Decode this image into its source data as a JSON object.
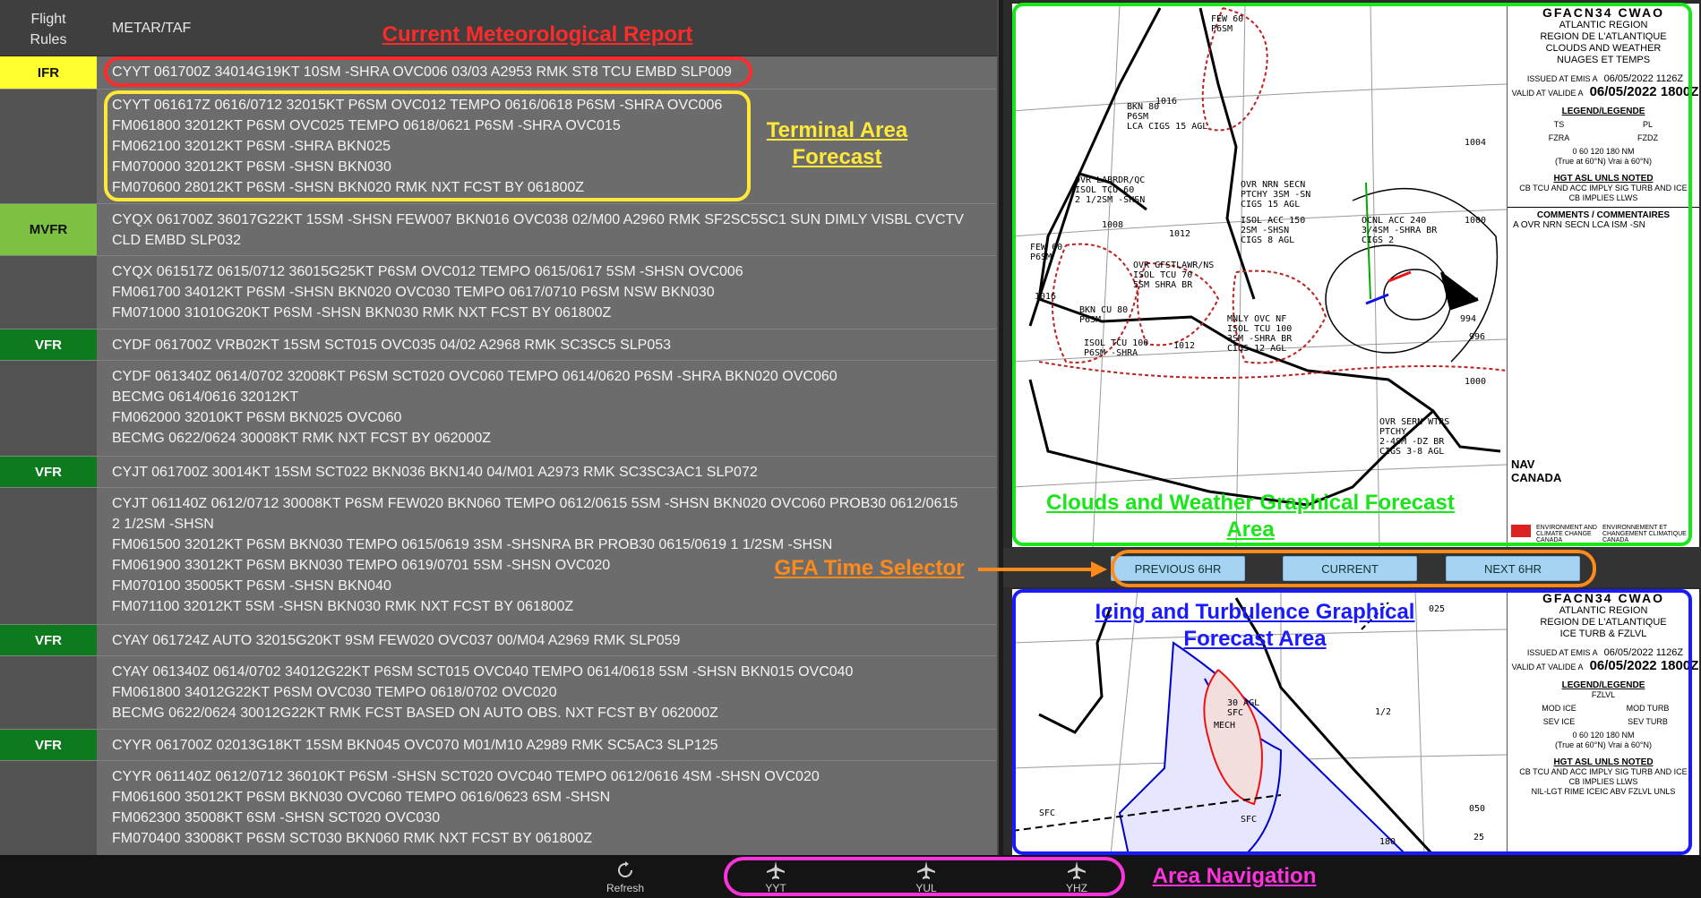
{
  "header": {
    "flight_rules": "Flight\nRules",
    "metar_taf": "METAR/TAF"
  },
  "rows": [
    {
      "rules": "IFR",
      "text": "CYYT 061700Z 34014G19KT 10SM -SHRA OVC006 03/03 A2953 RMK ST8 TCU EMBD SLP009"
    },
    {
      "rules": "",
      "text": "CYYT 061617Z 0616/0712 32015KT P6SM OVC012 TEMPO 0616/0618 P6SM -SHRA OVC006\nFM061800 32012KT P6SM OVC025 TEMPO 0618/0621 P6SM -SHRA OVC015\nFM062100 32012KT P6SM -SHRA BKN025\nFM070000 32012KT P6SM -SHSN BKN030\nFM070600 28012KT P6SM -SHSN BKN020 RMK NXT FCST BY 061800Z"
    },
    {
      "rules": "MVFR",
      "text": "CYQX 061700Z 36017G22KT 15SM -SHSN FEW007 BKN016 OVC038 02/M00 A2960 RMK SF2SC5SC1 SUN DIMLY VISBL CVCTV\nCLD EMBD SLP032"
    },
    {
      "rules": "",
      "text": "CYQX 061517Z 0615/0712 36015G25KT P6SM OVC012 TEMPO 0615/0617 5SM -SHSN OVC006\nFM061700 34012KT P6SM -SHSN BKN020 OVC030 TEMPO 0617/0710 P6SM NSW BKN030\nFM071000 31010G20KT P6SM -SHSN BKN030 RMK NXT FCST BY 061800Z"
    },
    {
      "rules": "VFR",
      "text": "CYDF 061700Z VRB02KT 15SM SCT015 OVC035 04/02 A2968 RMK SC3SC5 SLP053"
    },
    {
      "rules": "",
      "text": "CYDF 061340Z 0614/0702 32008KT P6SM SCT020 OVC060 TEMPO 0614/0620 P6SM -SHRA BKN020 OVC060\nBECMG 0614/0616 32012KT\nFM062000 32010KT P6SM BKN025 OVC060\nBECMG 0622/0624 30008KT RMK NXT FCST BY 062000Z"
    },
    {
      "rules": "VFR",
      "text": "CYJT 061700Z 30014KT 15SM SCT022 BKN036 BKN140 04/M01 A2973 RMK SC3SC3AC1 SLP072"
    },
    {
      "rules": "",
      "text": "CYJT 061140Z 0612/0712 30008KT P6SM FEW020 BKN060 TEMPO 0612/0615 5SM -SHSN BKN020 OVC060 PROB30 0612/0615\n2 1/2SM -SHSN\nFM061500 32012KT P6SM BKN030 TEMPO 0615/0619 3SM -SHSNRA BR PROB30 0615/0619 1 1/2SM -SHSN\nFM061900 33012KT P6SM BKN030 TEMPO 0619/0701 5SM -SHSN OVC020\nFM070100 35005KT P6SM -SHSN BKN040\nFM071100 32012KT 5SM -SHSN BKN030 RMK NXT FCST BY 061800Z"
    },
    {
      "rules": "VFR",
      "text": "CYAY 061724Z AUTO 32015G20KT 9SM FEW020 OVC037 00/M04 A2969 RMK SLP059"
    },
    {
      "rules": "",
      "text": "CYAY 061340Z 0614/0702 34012G22KT P6SM SCT015 OVC040 TEMPO 0614/0618 5SM -SHSN BKN015 OVC040\nFM061800 34012G22KT P6SM OVC030 TEMPO 0618/0702 OVC020\nBECMG 0622/0624 30012G22KT RMK FCST BASED ON AUTO OBS. NXT FCST BY 062000Z"
    },
    {
      "rules": "VFR",
      "text": "CYYR 061700Z 02013G18KT 15SM BKN045 OVC070 M01/M10 A2989 RMK SC5AC3 SLP125"
    },
    {
      "rules": "",
      "text": "CYYR 061140Z 0612/0712 36010KT P6SM -SHSN SCT020 OVC040 TEMPO 0612/0616 4SM -SHSN OVC020\nFM061600 35012KT P6SM BKN030 OVC060 TEMPO 0616/0623 6SM -SHSN\nFM062300 35008KT 6SM -SHSN SCT020 OVC030\nFM070400 33008KT P6SM SCT030 BKN060 RMK NXT FCST BY 061800Z"
    }
  ],
  "colors": {
    "ifr": "#ffff2e",
    "mvfr": "#7dc143",
    "vfr": "#0d7a1d",
    "annotation_red": "#ff2a2a",
    "annotation_yellow": "#ffe838",
    "annotation_green": "#19e619",
    "annotation_orange": "#ff8a1c",
    "annotation_blue": "#1a1aff",
    "annotation_magenta": "#ff33dd",
    "button_blue": "#a7d3f3"
  },
  "gfa_cw": {
    "code": "GFACN34  CWAO",
    "region_en": "ATLANTIC REGION",
    "region_fr": "REGION DE L'ATLANTIQUE",
    "product_en": "CLOUDS AND WEATHER",
    "product_fr": "NUAGES ET TEMPS",
    "issued_label": "ISSUED AT\nEMIS A",
    "issued": "06/05/2022 1126Z",
    "valid_label": "VALID AT\nVALIDE A",
    "valid": "06/05/2022 1800Z",
    "legend_title": "LEGEND/LEGENDE",
    "legend_items": [
      "TS",
      "PL",
      "FZRA",
      "FZDZ"
    ],
    "scale": "0   60  120   180 NM",
    "scale_note": "(True at 60°N)   Vrai à 60°N)",
    "hgt_note": "HGT ASL UNLS NOTED",
    "cb_note": "CB TCU AND ACC IMPLY SIG TURB AND ICE",
    "cb_note2": "CB IMPLIES LLWS",
    "comments_title": "COMMENTS / COMMENTAIRES",
    "comment": "A  OVR NRN SECN LCA ISM -SN",
    "nav_logo": "NAV\nCANADA",
    "env_text": "ENVIRONMENT AND\nCLIMATE CHANGE\nCANADA",
    "env_text_fr": "ENVIRONNEMENT ET\nCHANGEMENT CLIMATIQUE\nCANADA",
    "map_labels": [
      "BKN 80\nP6SM\nLCA CIGS 15 AGL",
      "OVR LABRDR/QC\nISOL TCU 60\n2 1/2SM -SHSN",
      "OVR NRN SECN\nPTCHY 3SM -SN\nCIGS 15 AGL",
      "ISOL ACC 150\n2SM -SHSN\nCIGS 8 AGL",
      "OVR GFSTLAWR/NS\nISOL TCU 70\n5SM SHRA BR",
      "BKN CU 80\nP6SM",
      "ISOL TCU 100\nP6SM -SHRA",
      "MNLY OVC NF\nISOL TCU 100\n3SM -SHRA BR\nCIGS 12 AGL",
      "OVR SERN WTRS\nPTCHY\n2-4SM -DZ BR\nCIGS 3-8 AGL",
      "FEW 60\nP6SM",
      "FEW 60\nP6SM",
      "OCNL ACC 240\n3/4SM -SHRA BR\nCIGS 2",
      "1004",
      "1000",
      "996",
      "994",
      "1000",
      "1012",
      "1012",
      "1016",
      "1016",
      "1008"
    ]
  },
  "gfa_it": {
    "code": "GFACN34  CWAO",
    "region_en": "ATLANTIC REGION",
    "region_fr": "REGION DE L'ATLANTIQUE",
    "product": "ICE TURB & FZLVL",
    "issued_label": "ISSUED AT\nEMIS A",
    "issued": "06/05/2022 1126Z",
    "valid_label": "VALID AT\nVALIDE A",
    "valid": "06/05/2022 1800Z",
    "legend_title": "LEGEND/LEGENDE",
    "fzlvl": "FZLVL",
    "legend_items": [
      "MOD ICE",
      "MOD TURB",
      "SEV ICE",
      "SEV TURB"
    ],
    "scale": "0   60  120   180 NM",
    "scale_note": "(True at 60°N)   Vrai à 60°N)",
    "hgt_note": "HGT ASL UNLS NOTED",
    "cb_note": "CB TCU AND ACC IMPLY SIG TURB AND ICE",
    "cb_note2": "CB IMPLIES LLWS",
    "nil_note": "NIL-LGT RIME ICEIC ABV FZLVL UNLS",
    "map_labels": [
      "MECH",
      "30 AGL\nSFC",
      "SFC",
      "SFC",
      "025",
      "050",
      "25",
      "1/2",
      "180"
    ]
  },
  "selector": {
    "prev": "PREVIOUS 6HR",
    "current": "CURRENT",
    "next": "NEXT 6HR"
  },
  "annotations": {
    "current_report": "Current Meteorological Report",
    "taf": "Terminal Area\nForecast",
    "gfa_cw": "Clouds and Weather Graphical Forecast\nArea",
    "gfa_time": "GFA Time Selector",
    "gfa_it": "Icing and Turbulence Graphical\nForecast Area",
    "area_nav": "Area Navigation"
  },
  "bottom_nav": {
    "refresh": "Refresh",
    "areas": [
      "YYT",
      "YUL",
      "YHZ"
    ]
  }
}
